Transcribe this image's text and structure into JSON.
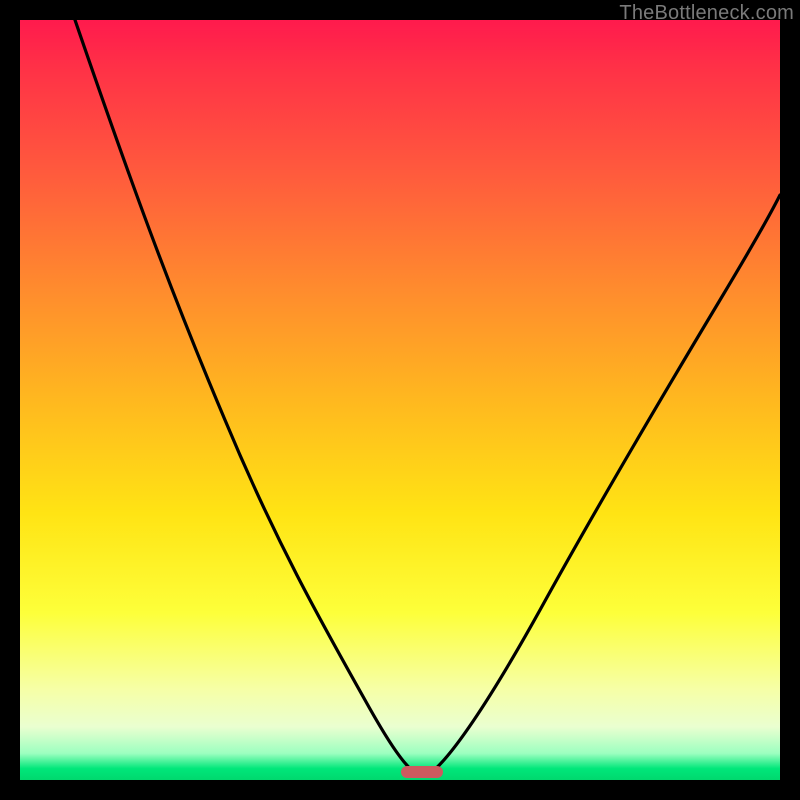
{
  "watermark": {
    "text": "TheBottleneck.com"
  },
  "chart_data": {
    "type": "line",
    "title": "",
    "xlabel": "",
    "ylabel": "",
    "xlim": [
      0,
      100
    ],
    "ylim": [
      0,
      100
    ],
    "grid": false,
    "legend": false,
    "background_gradient": {
      "direction": "vertical",
      "stops": [
        {
          "pos": 0,
          "color": "#ff1a4d"
        },
        {
          "pos": 0.35,
          "color": "#ff8a2e"
        },
        {
          "pos": 0.65,
          "color": "#ffe414"
        },
        {
          "pos": 0.88,
          "color": "#f6ffa6"
        },
        {
          "pos": 0.97,
          "color": "#9cffc0"
        },
        {
          "pos": 1.0,
          "color": "#00d86e"
        }
      ]
    },
    "series": [
      {
        "name": "bottleneck-curve",
        "color": "#000000",
        "x": [
          7,
          12,
          18,
          24,
          30,
          36,
          42,
          47,
          50,
          53,
          56,
          62,
          68,
          74,
          80,
          86,
          92,
          98
        ],
        "y": [
          100,
          90,
          80,
          70,
          59,
          47,
          33,
          17,
          3,
          0,
          3,
          15,
          28,
          40,
          51,
          61,
          70,
          78
        ]
      }
    ],
    "marker": {
      "x": 53,
      "y": 0,
      "color": "#cc5a5f",
      "shape": "pill"
    }
  },
  "colors": {
    "frame": "#000000",
    "curve": "#000000",
    "marker": "#cc5a5f",
    "watermark": "#7a7a7a"
  }
}
